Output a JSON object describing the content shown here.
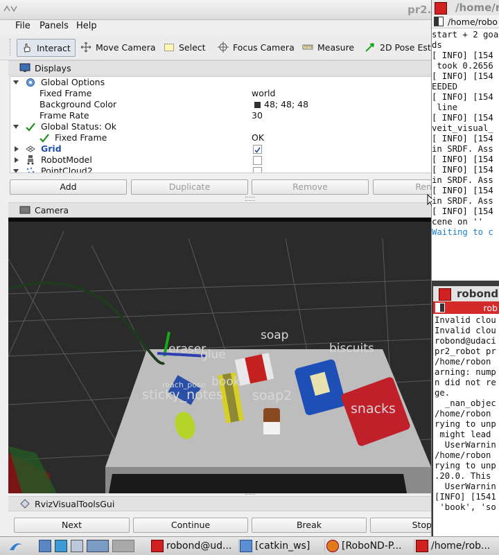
{
  "rviz": {
    "window_title": "pr2.",
    "menu": [
      "File",
      "Panels",
      "Help"
    ],
    "tools": {
      "interact": "Interact",
      "move_camera": "Move Camera",
      "select": "Select",
      "focus_camera": "Focus Camera",
      "measure": "Measure",
      "pose_estimate": "2D Pose Estin"
    },
    "displays_panel": {
      "title": "Displays",
      "rows": {
        "global_options": "Global Options",
        "fixed_frame": {
          "label": "Fixed Frame",
          "value": "world"
        },
        "background_color": {
          "label": "Background Color",
          "value": "48; 48; 48"
        },
        "frame_rate": {
          "label": "Frame Rate",
          "value": "30"
        },
        "global_status": "Global Status: Ok",
        "status_fixed_frame": {
          "label": "Fixed Frame",
          "value": "OK"
        },
        "grid": "Grid",
        "robot_model": "RobotModel",
        "pointcloud": "PointCloud2"
      },
      "buttons": {
        "add": "Add",
        "duplicate": "Duplicate",
        "remove": "Remove",
        "rename": "Ren"
      }
    },
    "camera_panel": {
      "title": "Camera",
      "labels": {
        "soap": "soap",
        "eraser": "eraser",
        "glue": "glue",
        "biscuits": "biscuits",
        "book": "book",
        "reach_pose": "reach_pose",
        "sticky_notes": "sticky_notes",
        "soap2": "soap2",
        "snacks": "snacks"
      }
    },
    "visual_tools": {
      "title": "RvizVisualToolsGui",
      "buttons": {
        "next": "Next",
        "continue": "Continue",
        "break": "Break",
        "stop": "Stop"
      }
    }
  },
  "terminal1": {
    "title": "/home/r",
    "tab": "/home/robo",
    "lines": [
      "start + 2 goa",
      "ds",
      "[ INFO] [154",
      " took 0.2656",
      "[ INFO] [154",
      "EEDED",
      "[ INFO] [154",
      " line",
      "[ INFO] [154",
      "veit_visual_",
      "[ INFO] [154",
      "in SRDF. Ass",
      "[ INFO] [154",
      "[ INFO] [154",
      "in SRDF. Ass",
      "[ INFO] [154",
      "in SRDF. Ass",
      "[ INFO] [154",
      "cene on ''",
      "",
      "Waiting to c"
    ]
  },
  "terminal2": {
    "title": "robond",
    "tab": "rob",
    "lines": [
      "Invalid clou",
      "Invalid clou",
      "robond@udaci",
      "pr2_robot pr",
      "/home/robon",
      "arning: nump",
      "n did not re",
      "ge.",
      "  _nan_objec",
      "/home/robon",
      "rying to unp",
      " might lead",
      "  UserWarnin",
      "/home/robon",
      "rying to unp",
      ".20.0. This",
      "  UserWarnin",
      "[INFO] [1541",
      " 'book', 'so"
    ]
  },
  "taskbar": {
    "tasks": [
      "robond@ud...",
      "[catkin_ws]",
      "[RoboND-P...",
      "/home/rob..."
    ]
  },
  "colors": {
    "accent": "#d02020",
    "link": "#1f4fb0",
    "status_ok": "#1a8f1a"
  }
}
